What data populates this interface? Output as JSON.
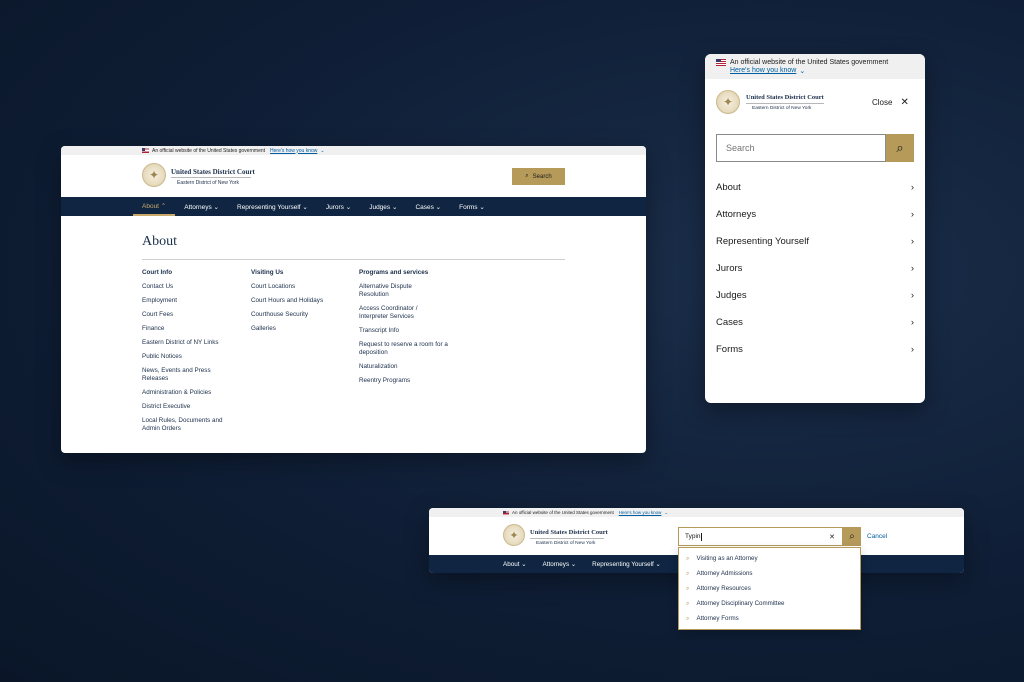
{
  "gov_banner": {
    "text": "An official website of the United States government",
    "link": "Here's how you know"
  },
  "court": {
    "name": "United States District Court",
    "district": "Eastern District of New York"
  },
  "desktop": {
    "search_label": "Search",
    "nav": [
      "About",
      "Attorneys",
      "Representing Yourself",
      "Jurors",
      "Judges",
      "Cases",
      "Forms"
    ],
    "page_title": "About",
    "columns": [
      {
        "heading": "Court Info",
        "links": [
          "Contact Us",
          "Employment",
          "Court Fees",
          "Finance",
          "Eastern District of NY Links",
          "Public Notices",
          "News, Events and Press Releases",
          "Administration & Policies",
          "District Executive",
          "Local Rules, Documents and Admin Orders"
        ]
      },
      {
        "heading": "Visiting Us",
        "links": [
          "Court Locations",
          "Court Hours and Holidays",
          "Courthouse Security",
          "Galleries"
        ]
      },
      {
        "heading": "Programs and services",
        "links": [
          "Alternative Dispute Resolution",
          "Access Coordinator / Interpreter Services",
          "Transcript Info",
          "Request to reserve a room for a deposition",
          "Naturalization",
          "Reentry Programs"
        ]
      }
    ]
  },
  "mobile": {
    "close_label": "Close",
    "search_placeholder": "Search",
    "menu": [
      "About",
      "Attorneys",
      "Representing Yourself",
      "Jurors",
      "Judges",
      "Cases",
      "Forms"
    ]
  },
  "search_demo": {
    "query": "Typin",
    "cancel_label": "Cancel",
    "nav": [
      "About",
      "Attorneys",
      "Representing Yourself"
    ],
    "suggestions": [
      "Visiting as an Attorney",
      "Attorney Admissions",
      "Attorney Resources",
      "Attorney Disciplinary Committee",
      "Attorney Forms"
    ]
  },
  "colors": {
    "navy": "#0f2542",
    "gold": "#b59a5a",
    "background": "#0f1e36"
  }
}
